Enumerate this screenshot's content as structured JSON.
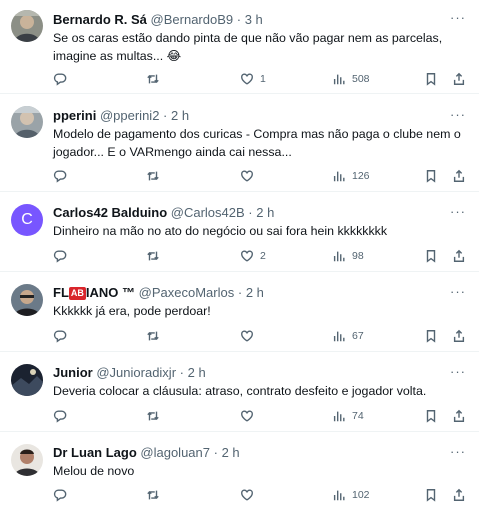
{
  "tweets": [
    {
      "name": "Bernardo R. Sá",
      "handle": "@BernardoB9",
      "time": "3 h",
      "text_line1": "Se os caras estão dando pinta de que não vão pagar nem as parcelas,",
      "text_line2": "imagine as multas... 😂",
      "replies": "",
      "retweets": "",
      "likes": "1",
      "views": "508"
    },
    {
      "name": "pperini",
      "handle": "@pperini2",
      "time": "2 h",
      "text_line1": "Modelo de pagamento dos curicas - Compra mas não paga o clube nem o",
      "text_line2": "jogador... E o VARmengo ainda cai nessa...",
      "replies": "",
      "retweets": "",
      "likes": "",
      "views": "126"
    },
    {
      "name": "Carlos42 Balduino",
      "handle": "@Carlos42B",
      "time": "2 h",
      "avatar_letter": "C",
      "text_line1": "Dinheiro na mão no ato do negócio ou sai fora hein kkkkkkkk",
      "text_line2": "",
      "replies": "",
      "retweets": "",
      "likes": "2",
      "views": "98"
    },
    {
      "name_pre": "FL",
      "name_badge": "AB",
      "name_post": "IANO ™",
      "handle": "@PaxecoMarlos",
      "time": "2 h",
      "text_line1": "Kkkkkk já era, pode perdoar!",
      "text_line2": "",
      "replies": "",
      "retweets": "",
      "likes": "",
      "views": "67"
    },
    {
      "name": "Junior",
      "handle": "@Junioradixjr",
      "time": "2 h",
      "text_line1": "Deveria colocar a cláusula: atraso, contrato desfeito e jogador volta.",
      "text_line2": "",
      "replies": "",
      "retweets": "",
      "likes": "",
      "views": "74"
    },
    {
      "name": "Dr Luan Lago",
      "handle": "@lagoluan7",
      "time": "2 h",
      "text_line1": "Melou de novo",
      "text_line2": "",
      "replies": "",
      "retweets": "",
      "likes": "",
      "views": "102"
    }
  ],
  "separator": "·",
  "more_label": "···",
  "icons": {
    "reply": "reply-icon",
    "retweet": "retweet-icon",
    "like": "heart-icon",
    "views": "views-icon",
    "bookmark": "bookmark-icon",
    "share": "share-icon"
  },
  "colors": {
    "text": "#0f1419",
    "secondary": "#536471",
    "divider": "#eff3f4",
    "avatar_c": "#7856ff"
  }
}
